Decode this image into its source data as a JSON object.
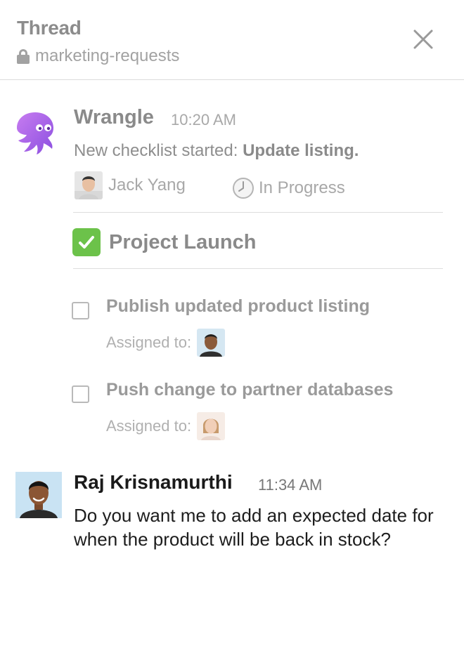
{
  "header": {
    "title": "Thread",
    "channel": "marketing-requests",
    "close_icon": "close-icon",
    "lock_icon": "lock-icon"
  },
  "bot_message": {
    "author": "Wrangle",
    "time": "10:20 AM",
    "text_prefix": "New checklist started: ",
    "text_bold": "Update listing.",
    "assignee_name": "Jack Yang",
    "status": "In Progress",
    "avatar_icon": "octopus-icon",
    "accent_color": "#a15ee8"
  },
  "checklist": {
    "title": "Project Launch",
    "check_color": "#6cc24a",
    "tasks": [
      {
        "title": "Publish updated product listing",
        "assigned_label": "Assigned to:",
        "checked": false
      },
      {
        "title": "Push change to partner databases",
        "assigned_label": "Assigned to:",
        "checked": false
      }
    ]
  },
  "user_message": {
    "author": "Raj Krisnamurthi",
    "time": "11:34 AM",
    "text": "Do you want me to add an expected date for when the product will be back in stock?"
  }
}
